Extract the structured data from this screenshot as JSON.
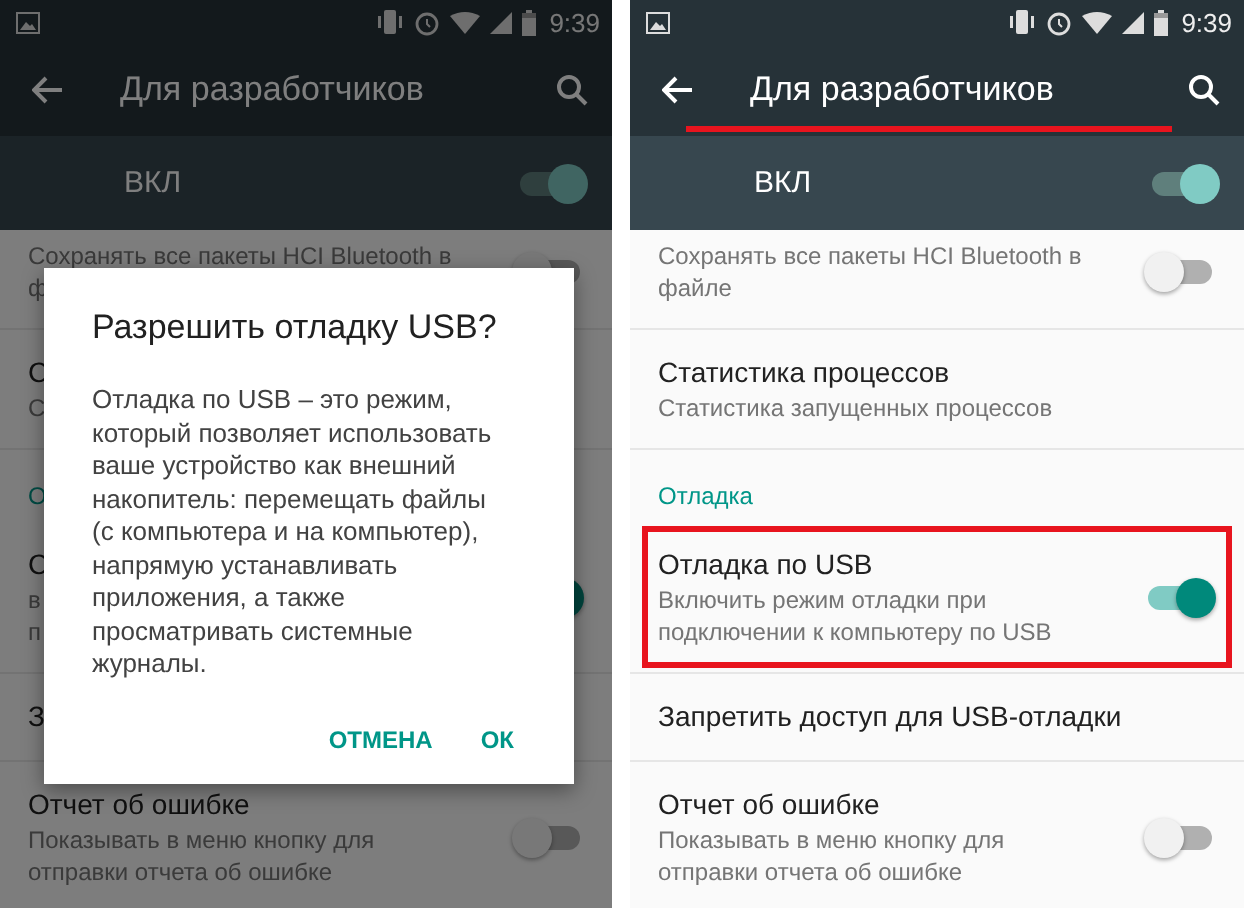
{
  "screens": [
    {
      "status_bar": {
        "time": "9:39"
      },
      "toolbar": {
        "title": "Для разработчиков"
      },
      "master_switch": {
        "label": "ВКЛ",
        "on": true
      },
      "items": [
        {
          "kind": "setting",
          "subtitle": "Сохранять все пакеты HCI Bluetooth в\nф",
          "on": false
        },
        {
          "kind": "setting",
          "title": "С",
          "subtitle": "С"
        },
        {
          "kind": "section",
          "title": "О"
        },
        {
          "kind": "setting",
          "title": "С",
          "subtitle": "в\nп",
          "on": true
        },
        {
          "kind": "setting",
          "title": "З"
        },
        {
          "kind": "setting",
          "title": "Отчет об ошибке",
          "subtitle": "Показывать в меню кнопку для\nотправки отчета об ошибке",
          "on": false
        }
      ],
      "dialog": {
        "title": "Разрешить отладку USB?",
        "body": "Отладка по USB – это режим,\nкоторый позволяет использовать\nваше устройство как внешний\nнакопитель: перемещать файлы\n(с компьютера и на компьютер),\nнапрямую устанавливать\nприложения, а также\nпросматривать системные\nжурналы.",
        "buttons": [
          "ОТМЕНА",
          "ОК"
        ]
      }
    },
    {
      "status_bar": {
        "time": "9:39"
      },
      "toolbar": {
        "title": "Для разработчиков",
        "title_underlined": true
      },
      "master_switch": {
        "label": "ВКЛ",
        "on": true
      },
      "items": [
        {
          "kind": "setting",
          "subtitle": "Сохранять все пакеты HCI Bluetooth в\nфайле",
          "on": false
        },
        {
          "kind": "setting",
          "title": "Статистика процессов",
          "subtitle": "Статистика запущенных процессов"
        },
        {
          "kind": "section",
          "title": "Отладка"
        },
        {
          "kind": "setting",
          "title": "Отладка по USB",
          "subtitle": "Включить режим отладки при\nподключении к компьютеру по USB",
          "on": true,
          "highlighted": true
        },
        {
          "kind": "setting",
          "title": "Запретить доступ для USB-отладки"
        },
        {
          "kind": "setting",
          "title": "Отчет об ошибке",
          "subtitle": "Показывать в меню кнопку для\nотправки отчета об ошибке",
          "on": false
        }
      ]
    }
  ]
}
